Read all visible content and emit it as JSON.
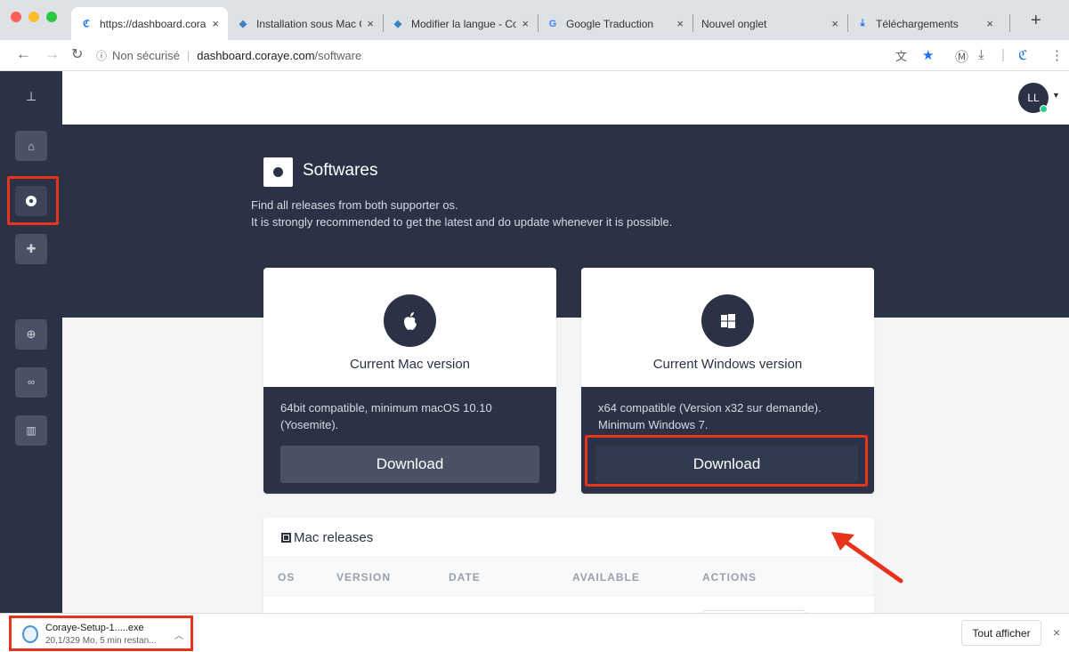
{
  "browser": {
    "tabs": [
      {
        "title": "https://dashboard.cora",
        "active": true,
        "icon": "coraye-favicon"
      },
      {
        "title": "Installation sous Mac C",
        "active": false,
        "icon": "docs-favicon"
      },
      {
        "title": "Modifier la langue - Co",
        "active": false,
        "icon": "docs-favicon"
      },
      {
        "title": "Google Traduction",
        "active": false,
        "icon": "translate-favicon"
      },
      {
        "title": "Nouvel onglet",
        "active": false,
        "icon": ""
      },
      {
        "title": "Téléchargements",
        "active": false,
        "icon": "download-favicon"
      }
    ],
    "tab_close": "×",
    "new_tab": "+",
    "address": {
      "security": "Non sécurisé",
      "host": "dashboard.coraye.com",
      "path": "/software"
    }
  },
  "sidebar": {
    "items": [
      {
        "name": "home",
        "icon": "home-icon"
      },
      {
        "name": "download",
        "icon": "download-circle-icon",
        "active": true
      },
      {
        "name": "extensions",
        "icon": "puzzle-icon"
      },
      {
        "name": "web",
        "icon": "globe-icon"
      },
      {
        "name": "glasses",
        "icon": "glasses-icon"
      },
      {
        "name": "docs",
        "icon": "book-icon"
      }
    ]
  },
  "header": {
    "avatar_initials": "LL"
  },
  "hero": {
    "title": "Softwares",
    "line1": "Find all releases from both supporter os.",
    "line2": "It is strongly recommended to get the latest and do update whenever it is possible."
  },
  "cards": {
    "mac": {
      "title": "Current Mac version",
      "line1": "64bit compatible, minimum macOS 10.10",
      "line2": "(Yosemite).",
      "button": "Download"
    },
    "windows": {
      "title": "Current Windows version",
      "line1": "x64 compatible (Version x32 sur demande).",
      "line2": "Minimum Windows 7.",
      "button": "Download"
    }
  },
  "releases": {
    "title": "Mac releases",
    "columns": [
      "OS",
      "VERSION",
      "DATE",
      "AVAILABLE",
      "ACTIONS"
    ]
  },
  "download_shelf": {
    "file_name": "Coraye-Setup-1.....exe",
    "status": "20,1/329 Mo, 5 min restan...",
    "show_all": "Tout afficher",
    "close": "×"
  },
  "colors": {
    "navy": "#2b3245",
    "highlight": "#e8331c"
  }
}
